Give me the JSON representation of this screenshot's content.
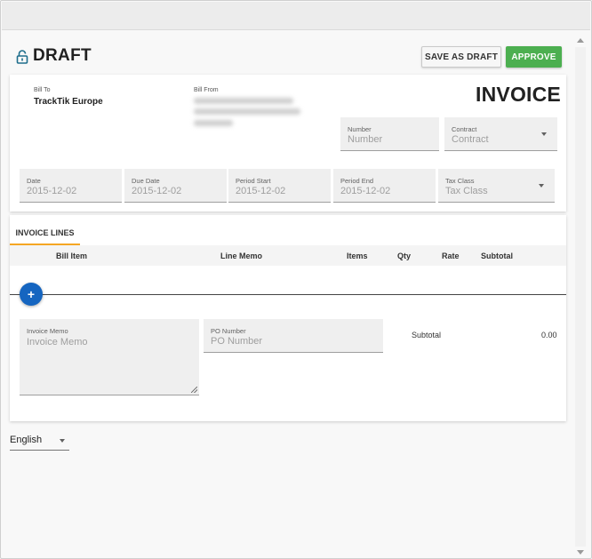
{
  "header": {
    "status": "DRAFT",
    "save_draft_label": "SAVE AS DRAFT",
    "approve_label": "APPROVE"
  },
  "invoice": {
    "title": "INVOICE",
    "bill_to_label": "Bill To",
    "bill_to_value": "TrackTik Europe",
    "bill_from_label": "Bill From",
    "number": {
      "label": "Number",
      "placeholder": "Number"
    },
    "contract": {
      "label": "Contract",
      "placeholder": "Contract"
    },
    "date": {
      "label": "Date",
      "value": "2015-12-02"
    },
    "due_date": {
      "label": "Due Date",
      "value": "2015-12-02"
    },
    "period_start": {
      "label": "Period Start",
      "value": "2015-12-02"
    },
    "period_end": {
      "label": "Period End",
      "value": "2015-12-02"
    },
    "tax_class": {
      "label": "Tax Class",
      "placeholder": "Tax Class"
    }
  },
  "lines": {
    "tab_label": "INVOICE LINES",
    "columns": [
      "Bill Item",
      "Line Memo",
      "Items",
      "Qty",
      "Rate",
      "Subtotal"
    ],
    "add_label": "+",
    "memo": {
      "label": "Invoice Memo",
      "placeholder": "Invoice Memo"
    },
    "po_number": {
      "label": "PO Number",
      "placeholder": "PO Number"
    },
    "subtotal_label": "Subtotal",
    "subtotal_value": "0.00"
  },
  "footer": {
    "language": "English"
  },
  "colors": {
    "approve": "#4caf50",
    "tab_accent": "#f5a623",
    "add_button": "#1565c0",
    "lock_icon": "#1f6e8c"
  }
}
